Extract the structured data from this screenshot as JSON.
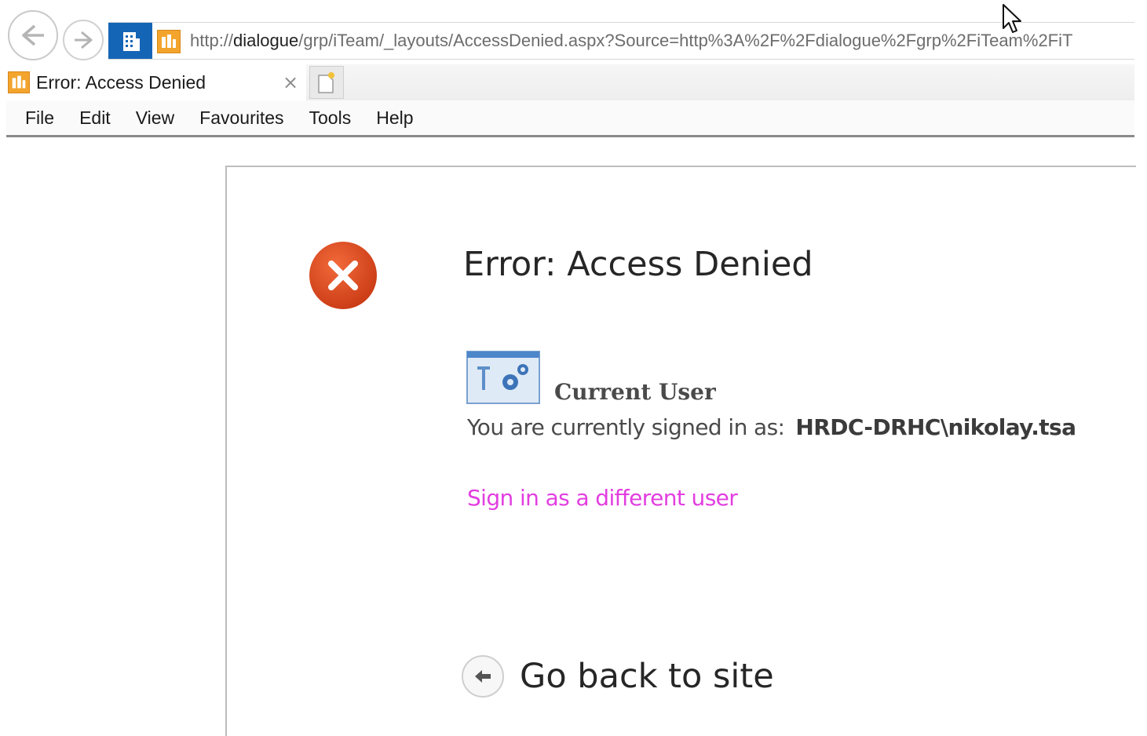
{
  "browser": {
    "url_prefix": "http://",
    "url_host": "dialogue",
    "url_rest": "/grp/iTeam/_layouts/AccessDenied.aspx?Source=http%3A%2F%2Fdialogue%2Fgrp%2FiTeam%2FiT",
    "tab_title": "Error: Access Denied",
    "tab_close": "×",
    "menu": [
      "File",
      "Edit",
      "View",
      "Favourites",
      "Tools",
      "Help"
    ],
    "icons": {
      "back": "back-arrow-icon",
      "forward": "forward-arrow-icon",
      "site": "building-icon",
      "favicon": "sharepoint-favicon-icon",
      "new_tab": "new-tab-icon"
    }
  },
  "page": {
    "title": "Error: Access Denied",
    "current_user_heading": "Current User",
    "signed_in_label": "You are currently signed in as:",
    "username": "HRDC-DRHC\\nikolay.tsa",
    "sign_in_link": "Sign in as a different user",
    "go_back": "Go back to site"
  },
  "colors": {
    "error_red": "#dd4b20",
    "link_magenta": "#e23ee0",
    "site_blue": "#1565b6",
    "favicon_orange": "#f3a42d"
  }
}
